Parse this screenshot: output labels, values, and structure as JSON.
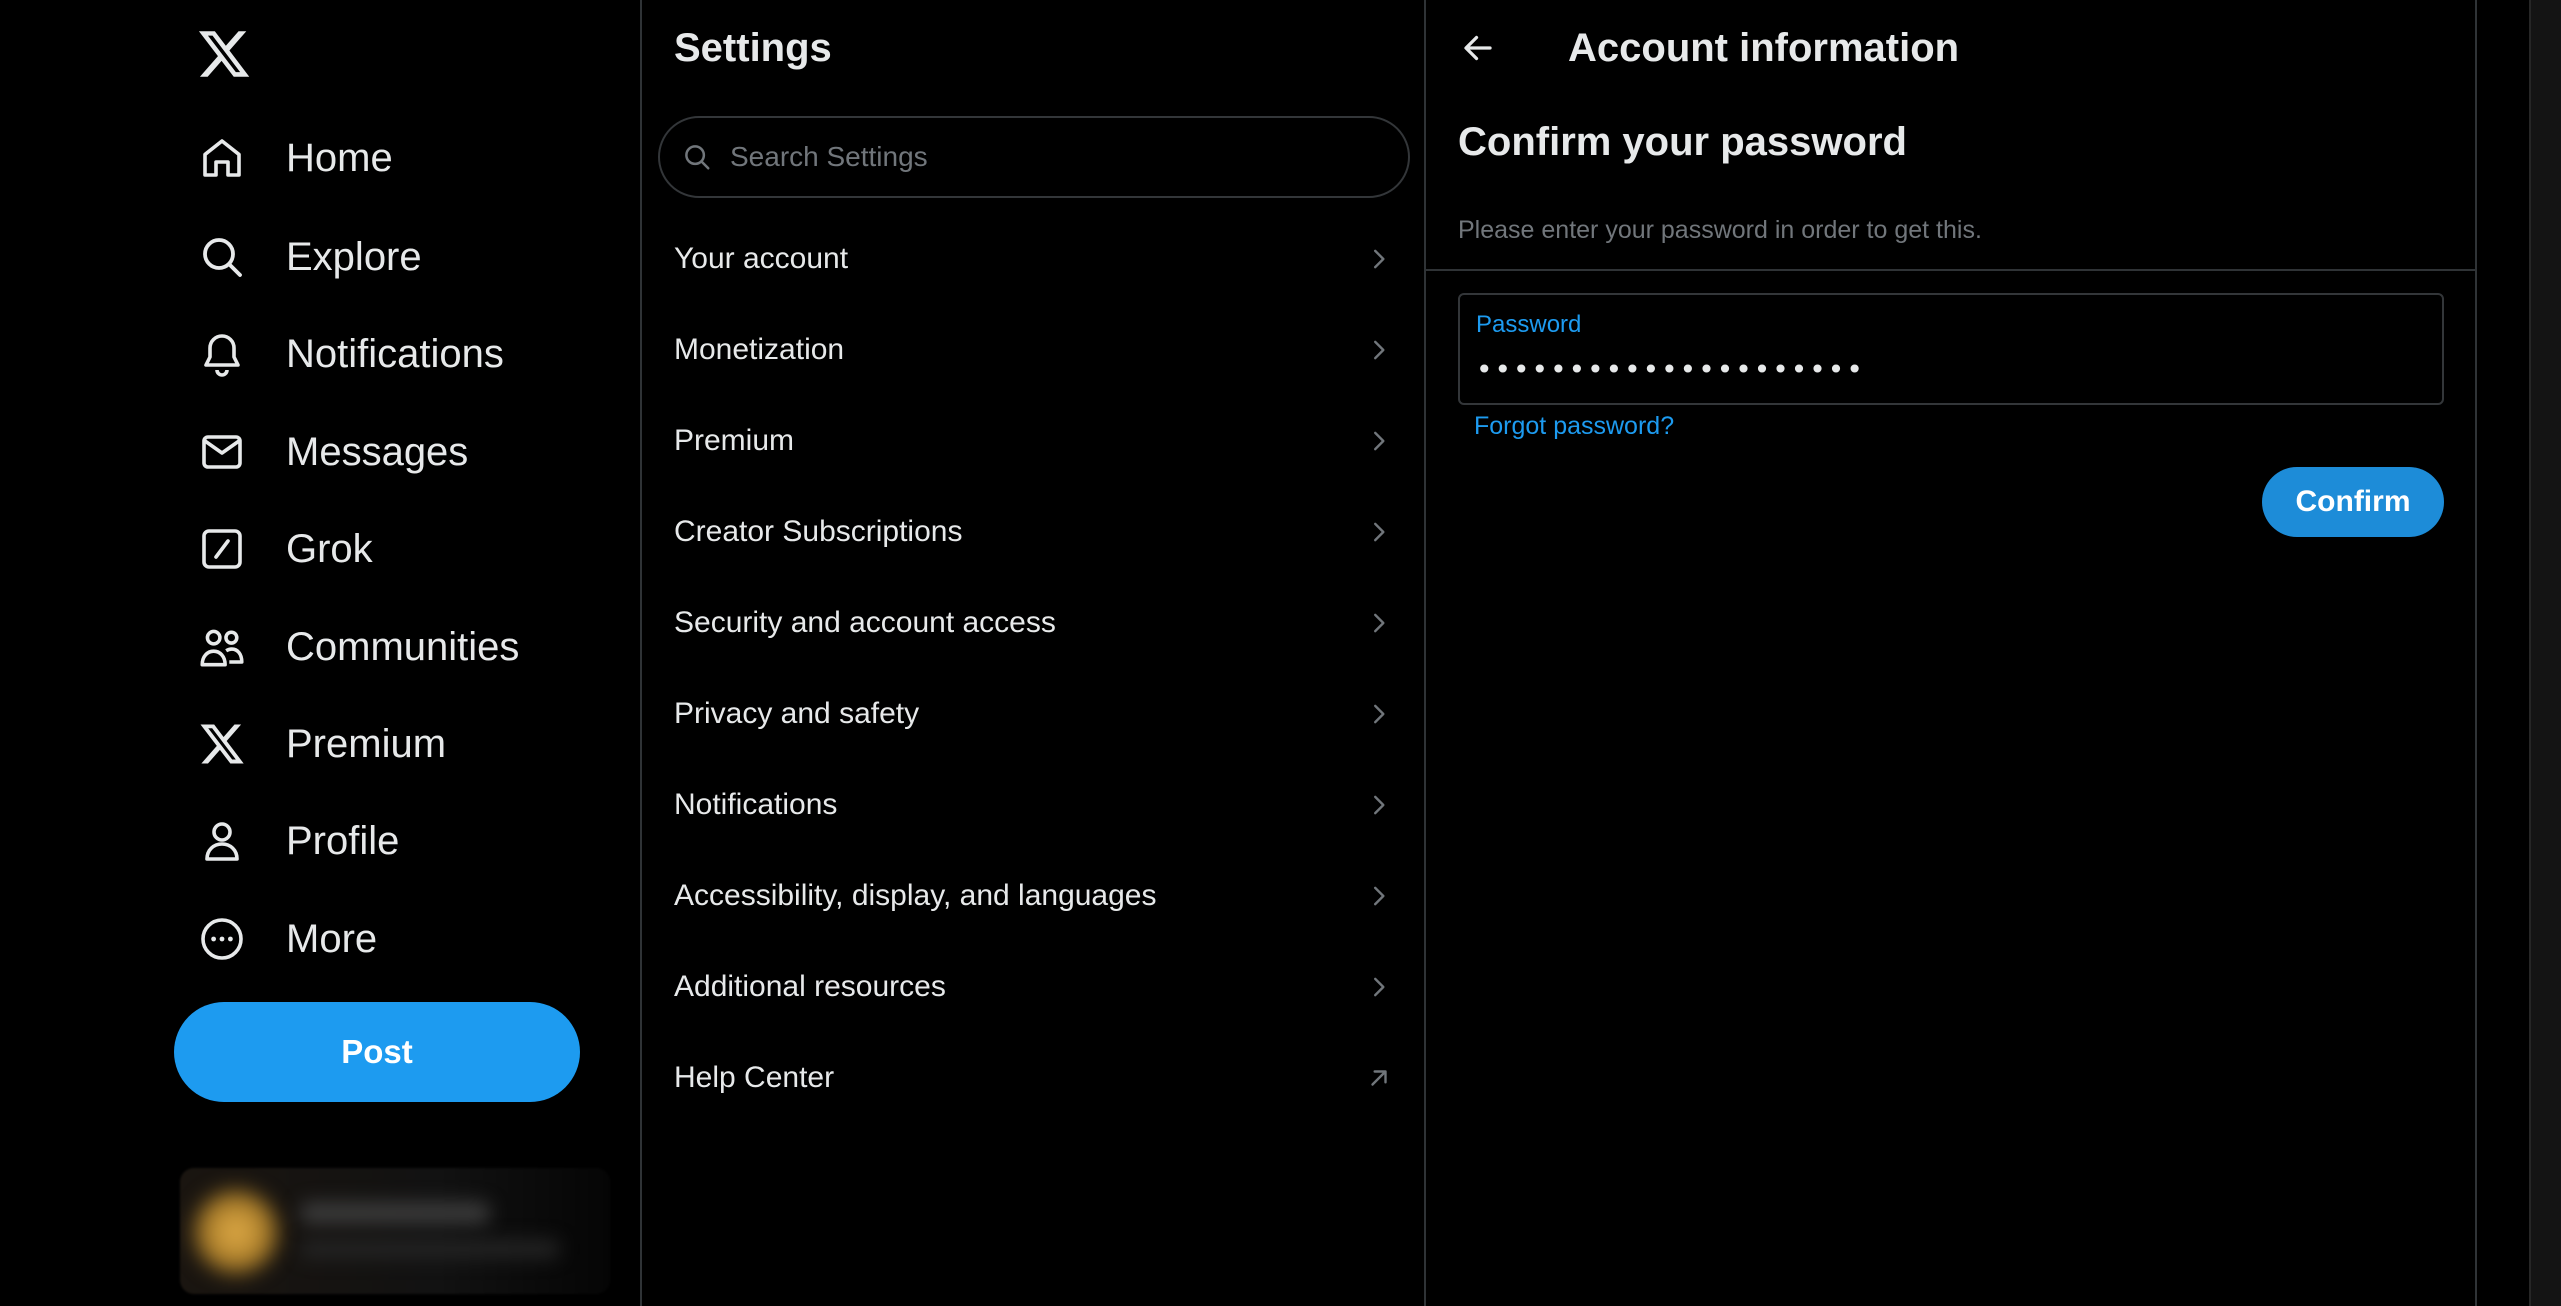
{
  "nav": {
    "logo_icon": "x-logo-icon",
    "items": [
      {
        "label": "Home",
        "icon": "home-icon"
      },
      {
        "label": "Explore",
        "icon": "search-icon"
      },
      {
        "label": "Notifications",
        "icon": "bell-icon"
      },
      {
        "label": "Messages",
        "icon": "envelope-icon"
      },
      {
        "label": "Grok",
        "icon": "grok-icon"
      },
      {
        "label": "Communities",
        "icon": "people-icon"
      },
      {
        "label": "Premium",
        "icon": "x-logo-icon"
      },
      {
        "label": "Profile",
        "icon": "person-icon"
      },
      {
        "label": "More",
        "icon": "more-circle-icon"
      }
    ],
    "post_label": "Post"
  },
  "settings": {
    "title": "Settings",
    "search_placeholder": "Search Settings",
    "items": [
      {
        "label": "Your account",
        "icon": "chevron-right-icon"
      },
      {
        "label": "Monetization",
        "icon": "chevron-right-icon"
      },
      {
        "label": "Premium",
        "icon": "chevron-right-icon"
      },
      {
        "label": "Creator Subscriptions",
        "icon": "chevron-right-icon"
      },
      {
        "label": "Security and account access",
        "icon": "chevron-right-icon"
      },
      {
        "label": "Privacy and safety",
        "icon": "chevron-right-icon"
      },
      {
        "label": "Notifications",
        "icon": "chevron-right-icon"
      },
      {
        "label": "Accessibility, display, and languages",
        "icon": "chevron-right-icon"
      },
      {
        "label": "Additional resources",
        "icon": "chevron-right-icon"
      },
      {
        "label": "Help Center",
        "icon": "external-arrow-icon"
      }
    ]
  },
  "detail": {
    "title": "Account information",
    "heading": "Confirm your password",
    "description": "Please enter your password in order to get this.",
    "password_label": "Password",
    "password_value": "•••••••••••••••••••••",
    "forgot_label": "Forgot password?",
    "confirm_label": "Confirm"
  },
  "colors": {
    "background": "#000000",
    "text": "#e7e9ea",
    "muted": "#71767b",
    "accent": "#1d9bf0",
    "border": "#2f3336"
  }
}
